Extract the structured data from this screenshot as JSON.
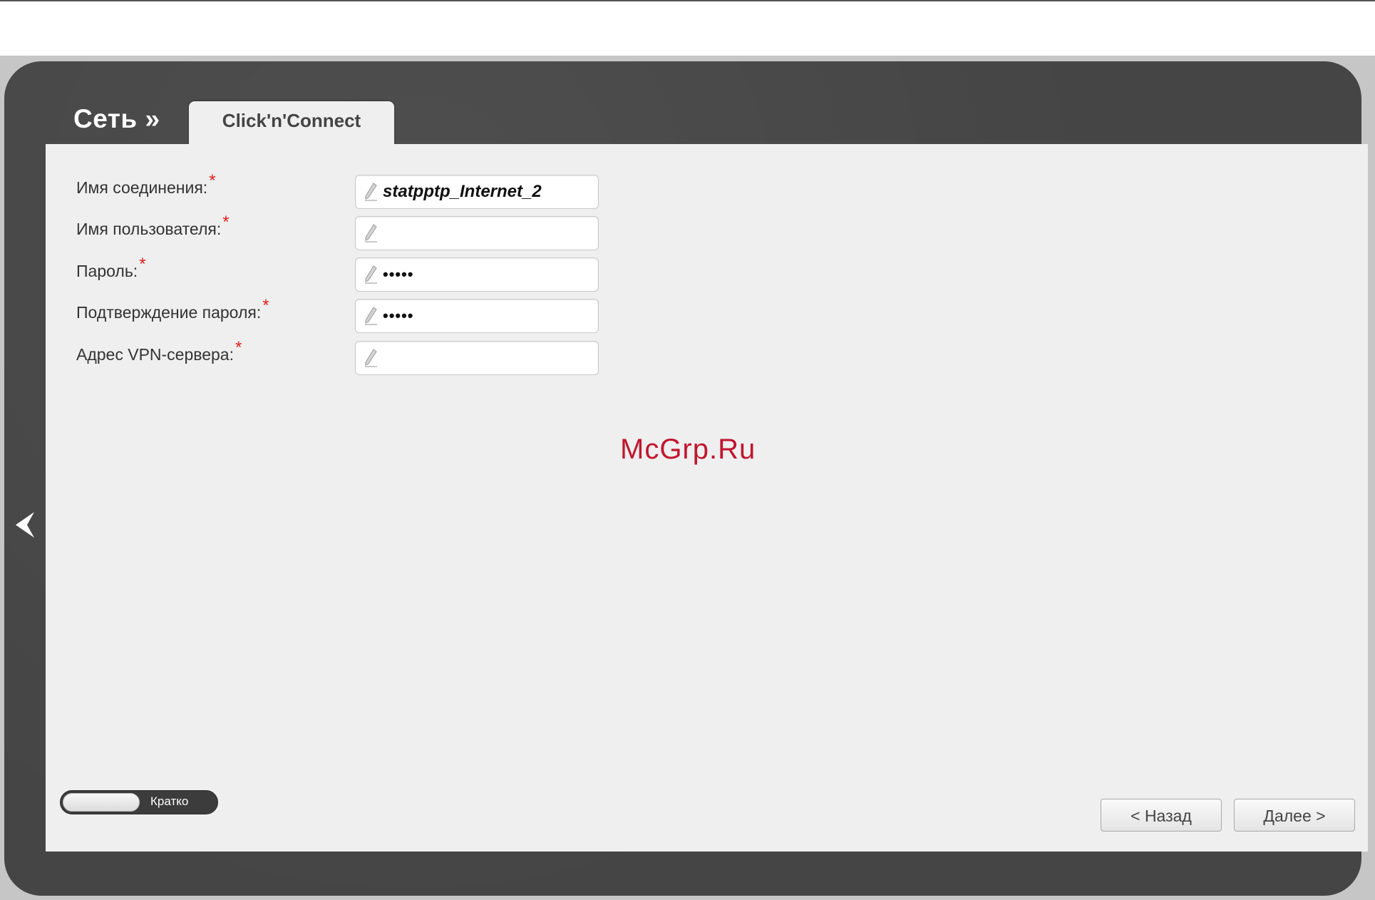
{
  "header": {
    "section_title": "Сеть »",
    "tab_label": "Click'n'Connect"
  },
  "form": {
    "required_mark": "*",
    "fields": [
      {
        "label": "Имя соединения:",
        "value": "statpptp_Internet_2",
        "icon": "pencil-icon"
      },
      {
        "label": "Имя пользователя:",
        "value": "",
        "icon": "pencil-icon"
      },
      {
        "label": "Пароль:",
        "value": "•••••",
        "icon": "pencil-icon"
      },
      {
        "label": "Подтверждение пароля:",
        "value": "•••••",
        "icon": "pencil-icon"
      },
      {
        "label": "Адрес VPN-сервера:",
        "value": "",
        "icon": "pencil-icon"
      }
    ]
  },
  "watermark": "McGrp.Ru",
  "footer": {
    "mode_toggle_label": "Кратко",
    "back_button": "< Назад",
    "next_button": "Далее >"
  },
  "nav": {
    "back_arrow_icon": "chevron-left-icon"
  },
  "colors": {
    "panel_dark": "#454545",
    "content_bg": "#efefef",
    "required": "#e02020",
    "watermark": "#c0162e"
  }
}
